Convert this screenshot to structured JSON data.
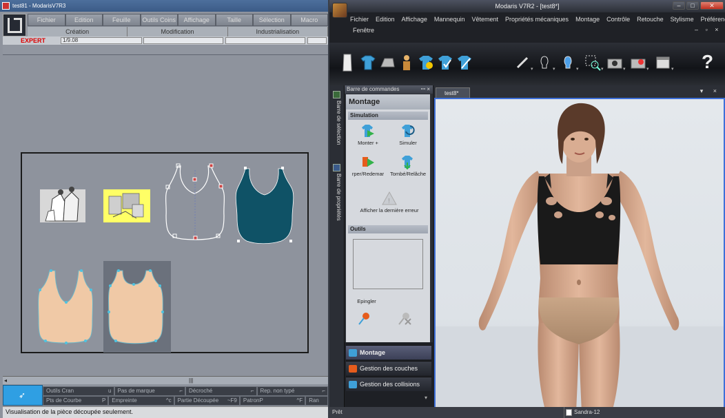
{
  "left_window": {
    "title": "test81 - ModarisV7R3",
    "menu": [
      "Fichier",
      "Edition",
      "Feuille",
      "Outils Coins",
      "Affichage",
      "Taille",
      "Sélection",
      "Macro"
    ],
    "tabs": [
      "Création",
      "Modification",
      "Industrialisation"
    ],
    "mode": "EXPERT",
    "ratio": "1/9.08",
    "bottom_rows": [
      [
        {
          "label": "Outils Cran",
          "key": "u"
        },
        {
          "label": "Pas de marque",
          "key": "⌐"
        },
        {
          "label": "Décroché",
          "key": "⌐"
        },
        {
          "label": "Rep. non typé",
          "key": "⌐"
        }
      ],
      [
        {
          "label": "Pts de Courbe",
          "key": "P"
        },
        {
          "label": "Empreinte",
          "key": "^c"
        },
        {
          "label": "Partie Découpée",
          "key": "~F9"
        },
        {
          "label": "PatronP",
          "key": "^F"
        },
        {
          "label": "Ran",
          "key": ""
        }
      ]
    ],
    "status": "Visualisation de la pièce découpée seulement."
  },
  "right_window": {
    "title": "Modaris V7R2 - [test8*]",
    "menu": [
      "Fichier",
      "Edition",
      "Affichage",
      "Mannequin",
      "Vêtement",
      "Propriétés mécaniques",
      "Montage",
      "Contrôle",
      "Retouche",
      "Stylisme",
      "Préférences"
    ],
    "window_menu": "Fenêtre",
    "help": "?",
    "side_labels": [
      "Barre de sélection",
      "Barre de propriétés"
    ],
    "cmd_header": "Barre de commandes",
    "panel_title": "Montage",
    "section_simulation": "Simulation",
    "cmd_montage": "Monter +",
    "cmd_simuler": "Simuler",
    "cmd_redemarrer": "rper/Redemar",
    "cmd_tombe": "Tombé/Relâche",
    "cmd_erreur": "Afficher la dernière erreur",
    "section_outils": "Outils",
    "cmd_epingler": "Epingler",
    "nav": [
      "Montage",
      "Gestion des couches",
      "Gestion des collisions"
    ],
    "tab": "test8*",
    "status_left": "Prêt",
    "status_model": "Sandra-12"
  },
  "colors": {
    "garment_teal": "#0f5266",
    "skin_panel": "#f0c9a6",
    "selection_yellow": "#ffff66",
    "top_black": "#1a1a1a",
    "accent_blue": "#3d6fd9"
  }
}
